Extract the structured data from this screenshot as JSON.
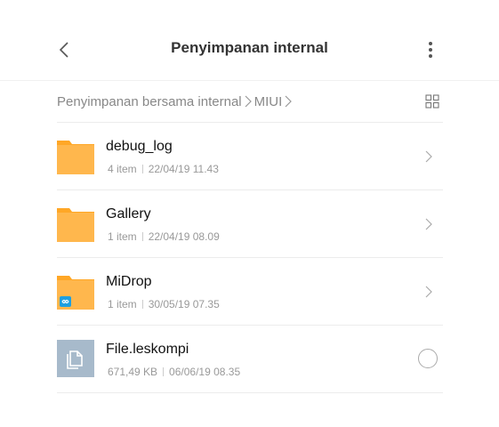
{
  "header": {
    "title": "Penyimpanan internal",
    "back_icon": "chevron-left-icon",
    "more_icon": "more-vertical-icon"
  },
  "breadcrumb": {
    "items": [
      "Penyimpanan bersama internal",
      "MIUI"
    ],
    "view_icon": "grid-view-icon"
  },
  "files": [
    {
      "name": "debug_log",
      "type": "folder",
      "count": "4 item",
      "date": "22/04/19 11.43",
      "trailing": "chevron"
    },
    {
      "name": "Gallery",
      "type": "folder",
      "count": "1 item",
      "date": "22/04/19 08.09",
      "trailing": "chevron"
    },
    {
      "name": "MiDrop",
      "type": "folder-midrop",
      "count": "1 item",
      "date": "30/05/19 07.35",
      "trailing": "chevron"
    },
    {
      "name": "File.leskompi",
      "type": "file",
      "count": "671,49 KB",
      "date": "06/06/19 08.35",
      "trailing": "radio"
    }
  ],
  "colors": {
    "folder": "#FFB74D",
    "folder_tab": "#FFA726",
    "file_icon_bg": "#A7BACB",
    "midrop_badge": "#1E9FE0"
  }
}
